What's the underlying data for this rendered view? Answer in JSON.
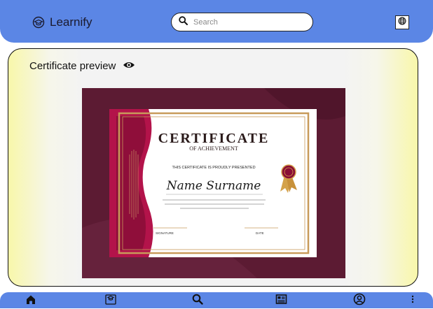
{
  "header": {
    "brand": "Learnify",
    "search": {
      "placeholder": "Search"
    }
  },
  "preview": {
    "title": "Certificate preview",
    "certificate": {
      "heading": "CERTIFICATE",
      "subheading": "OF ACHIEVEMENT",
      "presented_line": "THIS CERTIFICATE IS PROUDLY PRESENTED",
      "name": "Name Surname",
      "signature_label": "SIGNATURE",
      "date_label": "DATE"
    }
  },
  "bottom_nav": {
    "icons": [
      "home-icon",
      "course-icon",
      "search-icon",
      "news-icon",
      "profile-icon",
      "more-icon"
    ]
  },
  "colors": {
    "bar": "#5b86e5",
    "cert_burgundy": "#5c1b33",
    "cert_magenta": "#b3134a",
    "gold": "#c89a5a"
  }
}
